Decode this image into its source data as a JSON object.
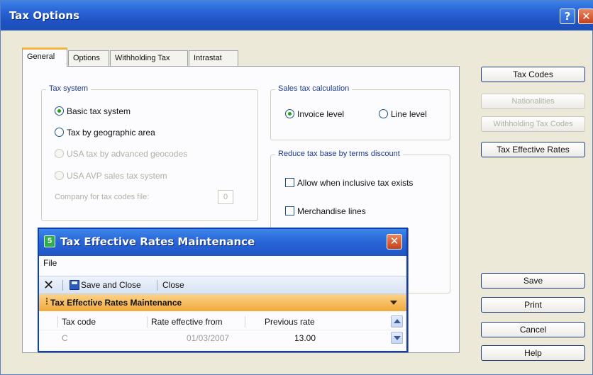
{
  "window": {
    "title": "Tax Options",
    "help_glyph": "?",
    "close_glyph": "✕"
  },
  "tabs": [
    {
      "label": "General",
      "active": true
    },
    {
      "label": "Options",
      "active": false
    },
    {
      "label": "Withholding Tax",
      "active": false
    },
    {
      "label": "Intrastat",
      "active": false
    }
  ],
  "tax_system": {
    "title": "Tax system",
    "options": [
      {
        "label": "Basic tax system",
        "selected": true,
        "enabled": true
      },
      {
        "label": "Tax by geographic area",
        "selected": false,
        "enabled": true
      },
      {
        "label": "USA tax by advanced geocodes",
        "selected": false,
        "enabled": false
      },
      {
        "label": "USA AVP sales tax system",
        "selected": false,
        "enabled": false
      }
    ],
    "company_label": "Company for tax codes file:",
    "company_value": "0"
  },
  "sales_tax": {
    "title": "Sales tax calculation",
    "options": [
      {
        "label": "Invoice level",
        "selected": true
      },
      {
        "label": "Line level",
        "selected": false
      }
    ]
  },
  "reduce_tax": {
    "title": "Reduce tax base by terms discount",
    "checks": [
      {
        "label": "Allow when inclusive tax exists",
        "checked": false
      },
      {
        "label": "Merchandise lines",
        "checked": false
      }
    ]
  },
  "side_buttons": [
    {
      "label": "Tax Codes",
      "enabled": true
    },
    {
      "label": "Nationalities",
      "enabled": false
    },
    {
      "label": "Withholding Tax Codes",
      "enabled": false
    },
    {
      "label": "Tax Effective Rates",
      "enabled": true
    }
  ],
  "action_buttons": [
    {
      "label": "Save"
    },
    {
      "label": "Print"
    },
    {
      "label": "Cancel"
    },
    {
      "label": "Help"
    }
  ],
  "dialog": {
    "title": "Tax Effective Rates Maintenance",
    "close_glyph": "✕",
    "menu": [
      "File"
    ],
    "toolbar": {
      "delete_glyph": "✕",
      "save_close": "Save and Close",
      "close": "Close"
    },
    "section": "Tax Effective Rates Maintenance",
    "columns": [
      "Tax code",
      "Rate effective from",
      "Previous rate"
    ],
    "rows": [
      {
        "tax_code": "C",
        "rate_effective_from": "01/03/2007",
        "previous_rate": "13.00"
      }
    ]
  }
}
